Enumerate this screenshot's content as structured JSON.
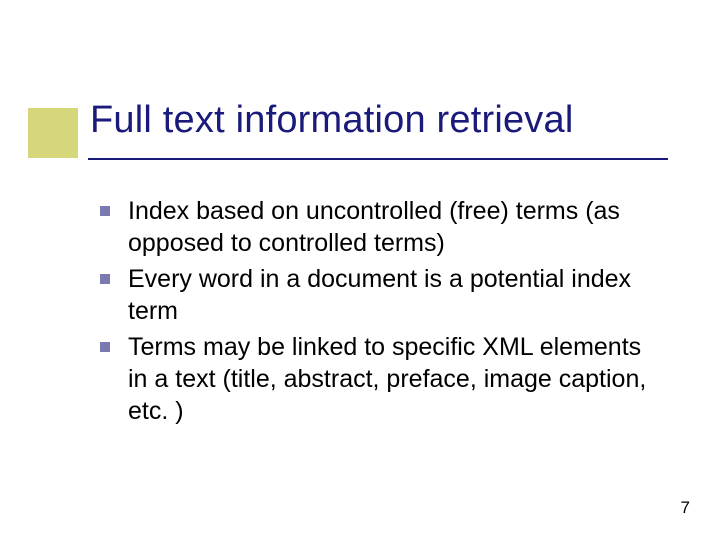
{
  "slide": {
    "title": "Full text information retrieval",
    "bullets": [
      "Index based on uncontrolled (free) terms (as opposed to controlled terms)",
      "Every word in a document is a potential index term",
      "Terms may be linked to specific XML elements in a text (title, abstract, preface, image caption, etc. )"
    ],
    "page_number": "7"
  }
}
